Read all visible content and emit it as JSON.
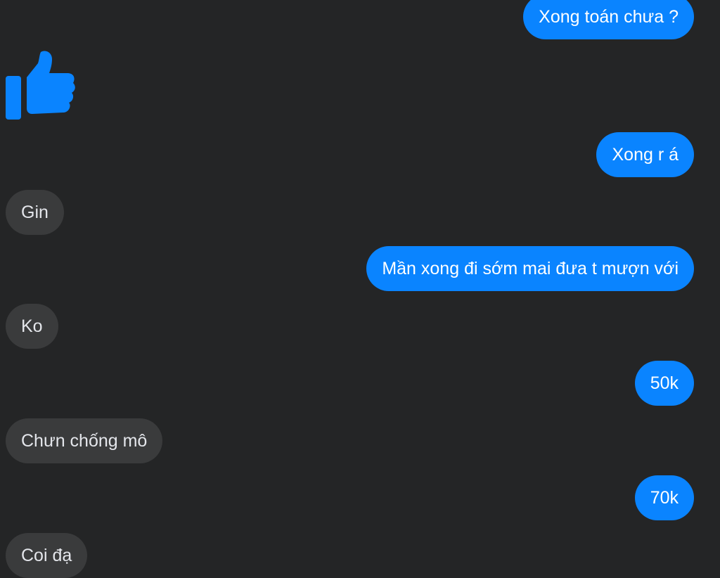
{
  "messages": [
    {
      "side": "sent",
      "text": "Xong toán chưa ?"
    },
    {
      "side": "recv",
      "type": "like-sticker",
      "icon": "thumbs-up-icon"
    },
    {
      "side": "sent",
      "text": "Xong r á"
    },
    {
      "side": "recv",
      "text": "Gin"
    },
    {
      "side": "sent",
      "text": "Mần xong đi sớm mai đưa t mượn với"
    },
    {
      "side": "recv",
      "text": "Ko"
    },
    {
      "side": "sent",
      "text": "50k"
    },
    {
      "side": "recv",
      "text": "Chưn chống mô"
    },
    {
      "side": "sent",
      "text": "70k"
    },
    {
      "side": "recv",
      "text": "Coi đạ"
    }
  ],
  "colors": {
    "background": "#242526",
    "sent_bubble": "#0a84ff",
    "received_bubble": "#3a3b3c",
    "like_icon": "#0a84ff"
  }
}
